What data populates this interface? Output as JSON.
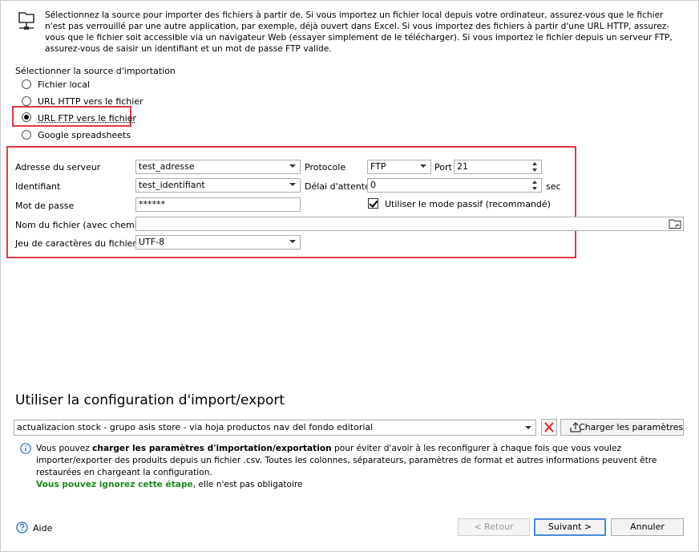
{
  "intro": {
    "icon": "network-computer-icon",
    "text": "Sélectionnez la source pour importer des fichiers à partir de. Si vous importez un fichier local depuis votre ordinateur, assurez-vous que le fichier n'est pas verrouillé par une autre application, par exemple, déjà ouvert dans Excel. Si vous importez des fichiers à partir d'une URL HTTP, assurez-vous que le fichier soit accessible via un navigateur Web (essayer simplement de le télécharger). Si vous importez le fichier depuis un serveur FTP, assurez-vous de saisir un identifiant et un mot de passe FTP valide."
  },
  "source": {
    "heading": "Sélectionner la source d'importation",
    "options": [
      {
        "label": "Fichier local",
        "checked": false
      },
      {
        "label": "URL HTTP vers le fichier",
        "checked": false
      },
      {
        "label": "URL FTP vers le fichier",
        "checked": true
      },
      {
        "label": "Google spreadsheets",
        "checked": false
      }
    ]
  },
  "ftp": {
    "server_label": "Adresse du serveur",
    "server_value": "test_adresse",
    "protocol_label": "Protocole",
    "protocol_value": "FTP",
    "port_label": "Port",
    "port_value": "21",
    "login_label": "Identifiant",
    "login_value": "test_identifiant",
    "timeout_label": "Délai d'attente",
    "timeout_value": "0",
    "timeout_unit": "sec",
    "password_label": "Mot de passe",
    "password_value": "******",
    "passive_label": "Utiliser le mode passif (recommandé)",
    "passive_checked": true,
    "filename_label": "Nom du fichier (avec chemin)",
    "filename_value": "",
    "charset_label": "Jeu de caractères du fichier",
    "charset_value": "UTF-8"
  },
  "config": {
    "title": "Utiliser la configuration d'import/export",
    "selected": "actualizacion stock - grupo asis store - via hoja productos nav del fondo editorial",
    "load_button": "Charger les paramètres",
    "info_before": "Vous pouvez ",
    "info_bold": "charger les paramètres d'importation/exportation",
    "info_after": " pour éviter d'avoir à les reconfigurer à chaque fois que vous voulez importer/exporter des produits depuis un fichier .csv. Toutes les colonnes, séparateurs, paramètres de format et autres informations peuvent être restaurées en chargeant la configuration.",
    "info_green": "Vous pouvez ignorez cette étape",
    "info_tail": ", elle n'est pas obligatoire"
  },
  "footer": {
    "help": "Aide",
    "back": "< Retour",
    "next": "Suivant >",
    "cancel": "Annuler"
  }
}
